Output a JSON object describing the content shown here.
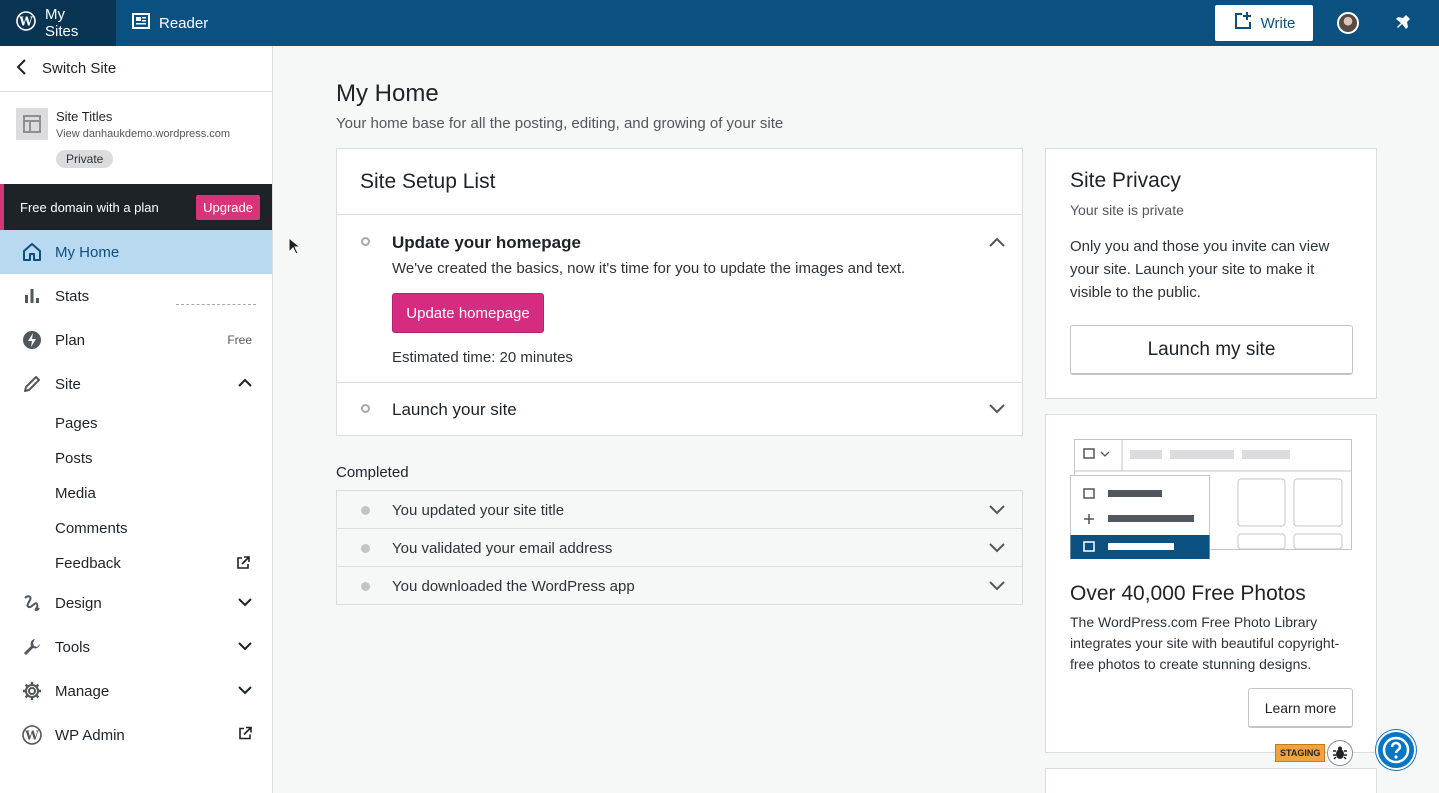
{
  "masterbar": {
    "my_sites": "My Sites",
    "reader": "Reader",
    "write": "Write",
    "bg_color": "#0a5182",
    "accent": "#d63679"
  },
  "sidebar": {
    "switch_site": "Switch Site",
    "site": {
      "title": "Site Titles",
      "url": "View danhaukdemo.wordpress.com",
      "badge": "Private"
    },
    "upsell": {
      "text": "Free domain with a plan",
      "button": "Upgrade"
    },
    "items": [
      {
        "label": "My Home",
        "icon": "home-icon"
      },
      {
        "label": "Stats",
        "icon": "stats-icon"
      },
      {
        "label": "Plan",
        "icon": "plan-icon",
        "right": "Free"
      },
      {
        "label": "Site",
        "icon": "pencil-icon"
      }
    ],
    "site_sub": [
      "Pages",
      "Posts",
      "Media",
      "Comments",
      "Feedback"
    ],
    "lower_items": [
      {
        "label": "Design",
        "icon": "design-icon"
      },
      {
        "label": "Tools",
        "icon": "wrench-icon"
      },
      {
        "label": "Manage",
        "icon": "gear-icon"
      },
      {
        "label": "WP Admin",
        "icon": "wordpress-icon"
      }
    ]
  },
  "main": {
    "title": "My Home",
    "subtitle": "Your home base for all the posting, editing, and growing of your site",
    "setup": {
      "title": "Site Setup List",
      "tasks": [
        {
          "title": "Update your homepage",
          "description": "We've created the basics, now it's time for you to update the images and text.",
          "button": "Update homepage",
          "estimate": "Estimated time: 20 minutes"
        },
        {
          "title": "Launch your site"
        }
      ]
    },
    "completed_label": "Completed",
    "completed": [
      "You updated your site title",
      "You validated your email address",
      "You downloaded the WordPress app"
    ],
    "privacy": {
      "title": "Site Privacy",
      "subtitle": "Your site is private",
      "body": "Only you and those you invite can view your site. Launch your site to make it visible to the public.",
      "button": "Launch my site"
    },
    "photos": {
      "title": "Over 40,000 Free Photos",
      "body": "The WordPress.com Free Photo Library integrates your site with beautiful copyright-free photos to create stunning designs.",
      "button": "Learn more"
    }
  },
  "staging_badge": "STAGING"
}
